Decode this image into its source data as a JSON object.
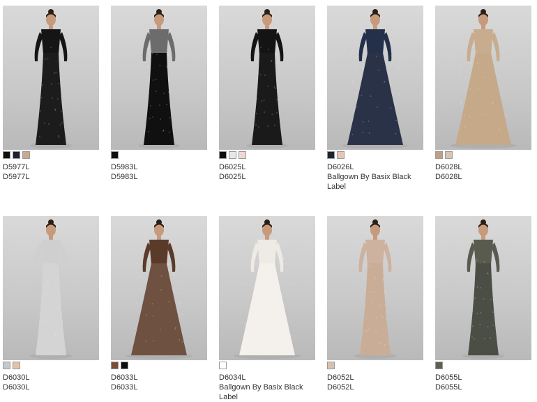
{
  "products": [
    {
      "sku": "D5977L",
      "name": "D5977L",
      "swatches": [
        "#0f0f0f",
        "#1a2230",
        "#c8a98d"
      ],
      "dress": "#1c1c1c",
      "top": "#151515"
    },
    {
      "sku": "D5983L",
      "name": "D5983L",
      "swatches": [
        "#0f0f0f"
      ],
      "dress": "#101010",
      "top": "#6c6c6c"
    },
    {
      "sku": "D6025L",
      "name": "D6025L",
      "swatches": [
        "#0d0d0d",
        "#e7e7e7",
        "#efd8cf"
      ],
      "dress": "#1a1a1a",
      "top": "#141414"
    },
    {
      "sku": "D6026L",
      "name": "Ballgown By Basix Black Label",
      "swatches": [
        "#1d2433",
        "#e7c6b6"
      ],
      "dress": "#2a3248",
      "top": "#24304a"
    },
    {
      "sku": "D6028L",
      "name": "D6028L",
      "swatches": [
        "#c69d84",
        "#d8c4b1"
      ],
      "dress": "#c5a989",
      "top": "#c8ac8e"
    },
    {
      "sku": "D6030L",
      "name": "D6030L",
      "swatches": [
        "#c6c9cc",
        "#e2c2a9"
      ],
      "dress": "#d4d4d4",
      "top": "#cfcfcf"
    },
    {
      "sku": "D6033L",
      "name": "D6033L",
      "swatches": [
        "#7a4c3a",
        "#0d0d0d"
      ],
      "dress": "#6e5140",
      "top": "#5a3b2a"
    },
    {
      "sku": "D6034L",
      "name": "Ballgown By Basix Black Label",
      "swatches": [
        "#ffffff"
      ],
      "dress": "#f4f1ec",
      "top": "#eeeae4"
    },
    {
      "sku": "D6052L",
      "name": "D6052L",
      "swatches": [
        "#d7c0b0"
      ],
      "dress": "#c9ad97",
      "top": "#cdb29f"
    },
    {
      "sku": "D6055L",
      "name": "D6055L",
      "swatches": [
        "#5d5f55"
      ],
      "dress": "#4a4e44",
      "top": "#595b4e"
    }
  ]
}
